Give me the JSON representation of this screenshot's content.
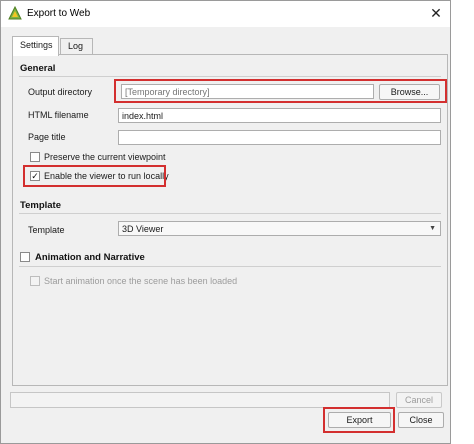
{
  "window": {
    "title": "Export to Web",
    "close_glyph": "✕",
    "icon": "qgis-icon"
  },
  "tabs": [
    {
      "label": "Settings"
    },
    {
      "label": "Log"
    }
  ],
  "general": {
    "title": "General",
    "output_directory": {
      "label": "Output directory",
      "placeholder": "[Temporary directory]",
      "browse_label": "Browse..."
    },
    "html_filename": {
      "label": "HTML filename",
      "value": "index.html"
    },
    "page_title": {
      "label": "Page title",
      "value": ""
    },
    "preserve_viewpoint": {
      "label": "Preserve the current viewpoint",
      "checked": false
    },
    "run_locally": {
      "label": "Enable the viewer to run locally",
      "checked": true
    }
  },
  "template": {
    "title": "Template",
    "label": "Template",
    "selected": "3D Viewer"
  },
  "animation": {
    "title": "Animation and Narrative",
    "checked": false,
    "start_animation": {
      "label": "Start animation once the scene has been loaded",
      "checked": false,
      "enabled": false
    }
  },
  "footer": {
    "cancel_label": "Cancel",
    "export_label": "Export",
    "close_label": "Close"
  },
  "colors": {
    "highlight": "#d32f2f",
    "accent": "#7cb342"
  }
}
